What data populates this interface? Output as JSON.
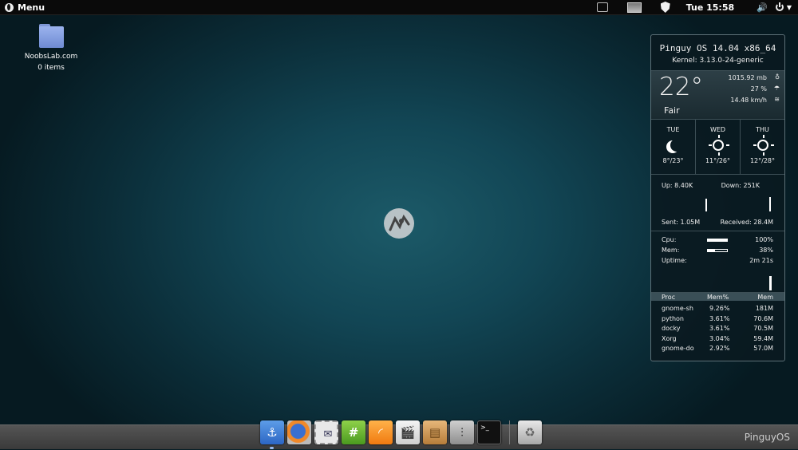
{
  "top_panel": {
    "menu_label": "Menu",
    "clock": "Tue 15:58",
    "icons": [
      "screen-icon",
      "monitor-icon",
      "shield-icon",
      "volume-icon",
      "power-icon"
    ]
  },
  "desktop": {
    "folder": {
      "name": "NoobsLab.com",
      "subtitle": "0 items"
    }
  },
  "conky": {
    "os": "Pinguy OS 14.04 x86_64",
    "kernel": "Kernel: 3.13.0-24-generic",
    "weather": {
      "temp": "22°",
      "condition": "Fair",
      "pressure": "1015.92 mb",
      "humidity": "27 %",
      "wind": "14.48 km/h"
    },
    "forecast": [
      {
        "day": "TUE",
        "icon": "moon-icon",
        "range": "8°/23°"
      },
      {
        "day": "WED",
        "icon": "sun-icon",
        "range": "11°/26°"
      },
      {
        "day": "THU",
        "icon": "sun-icon",
        "range": "12°/28°"
      }
    ],
    "net": {
      "up": "Up: 8.40K",
      "down": "Down: 251K",
      "sent": "Sent: 1.05M",
      "received": "Received: 28.4M"
    },
    "sys": {
      "cpu_label": "Cpu:",
      "cpu_value": "100%",
      "cpu_fraction": 1.0,
      "mem_label": "Mem:",
      "mem_value": "38%",
      "mem_fraction": 0.38,
      "uptime_label": "Uptime:",
      "uptime_value": "2m 21s"
    },
    "proc": {
      "headers": [
        "Proc",
        "Mem%",
        "Mem"
      ],
      "rows": [
        [
          "gnome-sh",
          "9.26%",
          "181M"
        ],
        [
          "python",
          "3.61%",
          "70.6M"
        ],
        [
          "docky",
          "3.61%",
          "70.5M"
        ],
        [
          "Xorg",
          "3.04%",
          "59.4M"
        ],
        [
          "gnome-do",
          "2.92%",
          "57.0M"
        ]
      ]
    }
  },
  "dock": {
    "apps": [
      "docky-anchor-icon",
      "firefox-icon",
      "mail-stamp-icon",
      "hash-chat-icon",
      "rss-feed-icon",
      "video-clapper-icon",
      "file-manager-icon",
      "mixer-settings-icon",
      "terminal-icon",
      "trash-icon"
    ],
    "brand": "PinguyOS"
  }
}
